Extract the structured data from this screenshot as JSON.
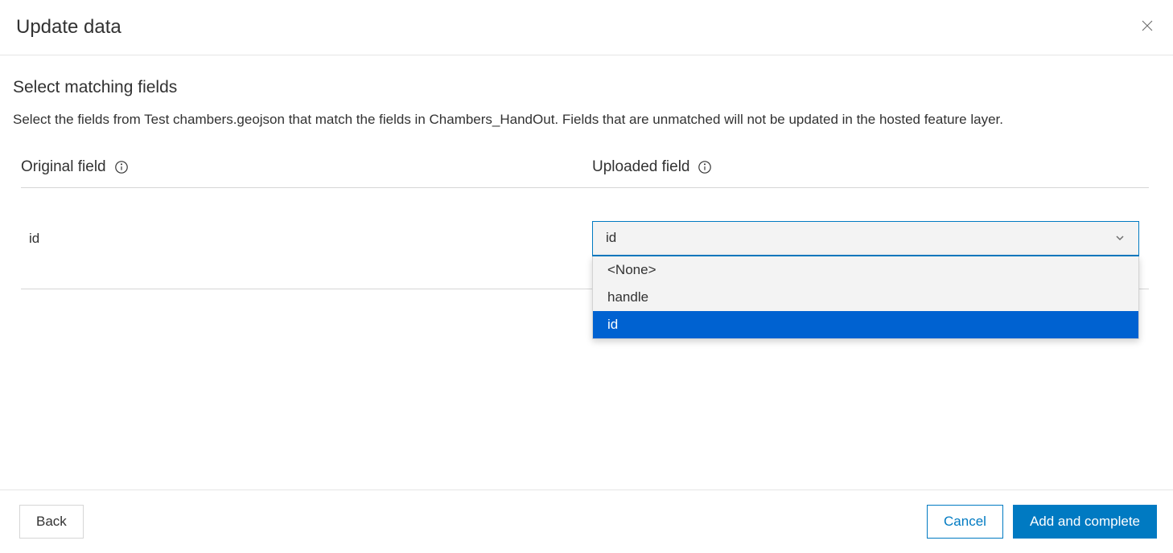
{
  "header": {
    "title": "Update data"
  },
  "section": {
    "title": "Select matching fields",
    "description": "Select the fields from Test chambers.geojson that match the fields in Chambers_HandOut. Fields that are unmatched will not be updated in the hosted feature layer."
  },
  "columns": {
    "original_label": "Original field",
    "uploaded_label": "Uploaded field"
  },
  "row": {
    "original_value": "id",
    "select_value": "id",
    "options": {
      "none": "<None>",
      "handle": "handle",
      "id": "id"
    }
  },
  "footer": {
    "back": "Back",
    "cancel": "Cancel",
    "primary": "Add and complete"
  }
}
